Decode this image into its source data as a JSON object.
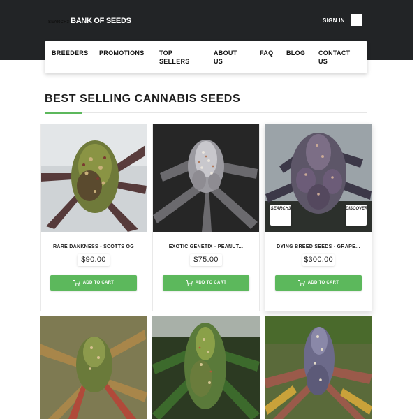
{
  "header": {
    "logo_small": "SEARCH3",
    "logo_main": "BANK OF SEEDS",
    "sign_in": "SIGN IN"
  },
  "nav": {
    "breeders": "BREEDERS",
    "promotions": "PROMOTIONS",
    "top_sellers_1": "TOP",
    "top_sellers_2": "SELLERS",
    "about_1": "ABOUT",
    "about_2": "US",
    "faq": "FAQ",
    "blog": "BLOG",
    "contact_1": "CONTACT",
    "contact_2": "US"
  },
  "section": {
    "title": "BEST SELLING CANNABIS SEEDS"
  },
  "products": [
    {
      "name": "RARE DANKNESS - SCOTTS OG",
      "price": "$90.00",
      "button": "ADD TO CART"
    },
    {
      "name": "EXOTIC GENETIX - PEANUT...",
      "price": "$75.00",
      "button": "ADD TO CART"
    },
    {
      "name": "DYING BREED SEEDS - GRAPE...",
      "price": "$300.00",
      "button": "ADD TO CART"
    }
  ],
  "overlay": {
    "left": "SEARCH3",
    "right": "DISCOVER"
  },
  "colors": {
    "header_bg": "#222426",
    "accent_green": "#5cb85c"
  }
}
